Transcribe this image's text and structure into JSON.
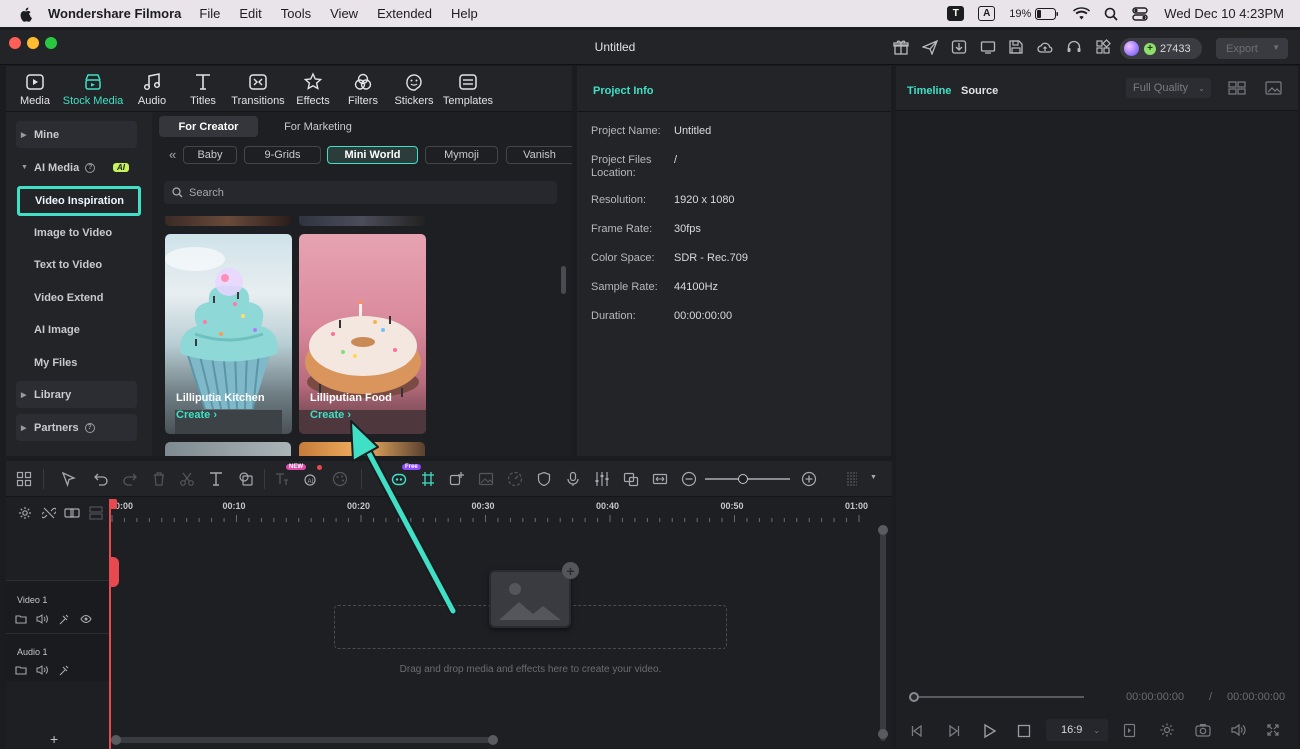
{
  "menubar": {
    "app_name": "Wondershare Filmora",
    "items": [
      "File",
      "Edit",
      "Tools",
      "View",
      "Extended",
      "Help"
    ],
    "battery": "19%",
    "datetime": "Wed Dec 10  4:23PM"
  },
  "window": {
    "title": "Untitled",
    "credits": "27433",
    "export_label": "Export"
  },
  "toolbar_tabs": [
    "Media",
    "Stock Media",
    "Audio",
    "Titles",
    "Transitions",
    "Effects",
    "Filters",
    "Stickers",
    "Templates"
  ],
  "sidebar": {
    "mine": "Mine",
    "ai_media": "AI Media",
    "ai_badge": "AI",
    "items": [
      "Video Inspiration",
      "Image to Video",
      "Text to Video",
      "Video Extend",
      "AI Image",
      "My Files"
    ],
    "library": "Library",
    "partners": "Partners"
  },
  "content": {
    "tab_creator": "For Creator",
    "tab_marketing": "For Marketing",
    "categories": [
      "Baby",
      "9-Grids",
      "Mini World",
      "Mymoji",
      "Vanish"
    ],
    "search_placeholder": "Search",
    "cards": [
      {
        "name": "Lilliputia Kitchen",
        "action": "Create"
      },
      {
        "name": "Lilliputian Food",
        "action": "Create"
      }
    ]
  },
  "project_info": {
    "header": "Project Info",
    "rows": [
      {
        "label": "Project Name:",
        "value": "Untitled"
      },
      {
        "label": "Project Files Location:",
        "value": "/"
      },
      {
        "label": "Resolution:",
        "value": "1920 x 1080"
      },
      {
        "label": "Frame Rate:",
        "value": "30fps"
      },
      {
        "label": "Color Space:",
        "value": "SDR - Rec.709"
      },
      {
        "label": "Sample Rate:",
        "value": "44100Hz"
      },
      {
        "label": "Duration:",
        "value": "00:00:00:00"
      }
    ]
  },
  "preview": {
    "tab_timeline": "Timeline",
    "tab_source": "Source",
    "quality": "Full Quality",
    "time_current": "00:00:00:00",
    "time_separator": "/",
    "time_total": "00:00:00:00",
    "aspect": "16:9"
  },
  "timeline": {
    "badge_new": "NEW",
    "badge_free": "Free",
    "ruler": [
      "00:00",
      "00:10",
      "00:20",
      "00:30",
      "00:40",
      "00:50",
      "01:00"
    ],
    "video_track": "Video 1",
    "audio_track": "Audio 1",
    "drop_hint": "Drag and drop media and effects here to create your video.",
    "zoom_level": 0.45
  },
  "colors": {
    "accent": "#3fe0c5",
    "playhead": "#e8494f"
  }
}
